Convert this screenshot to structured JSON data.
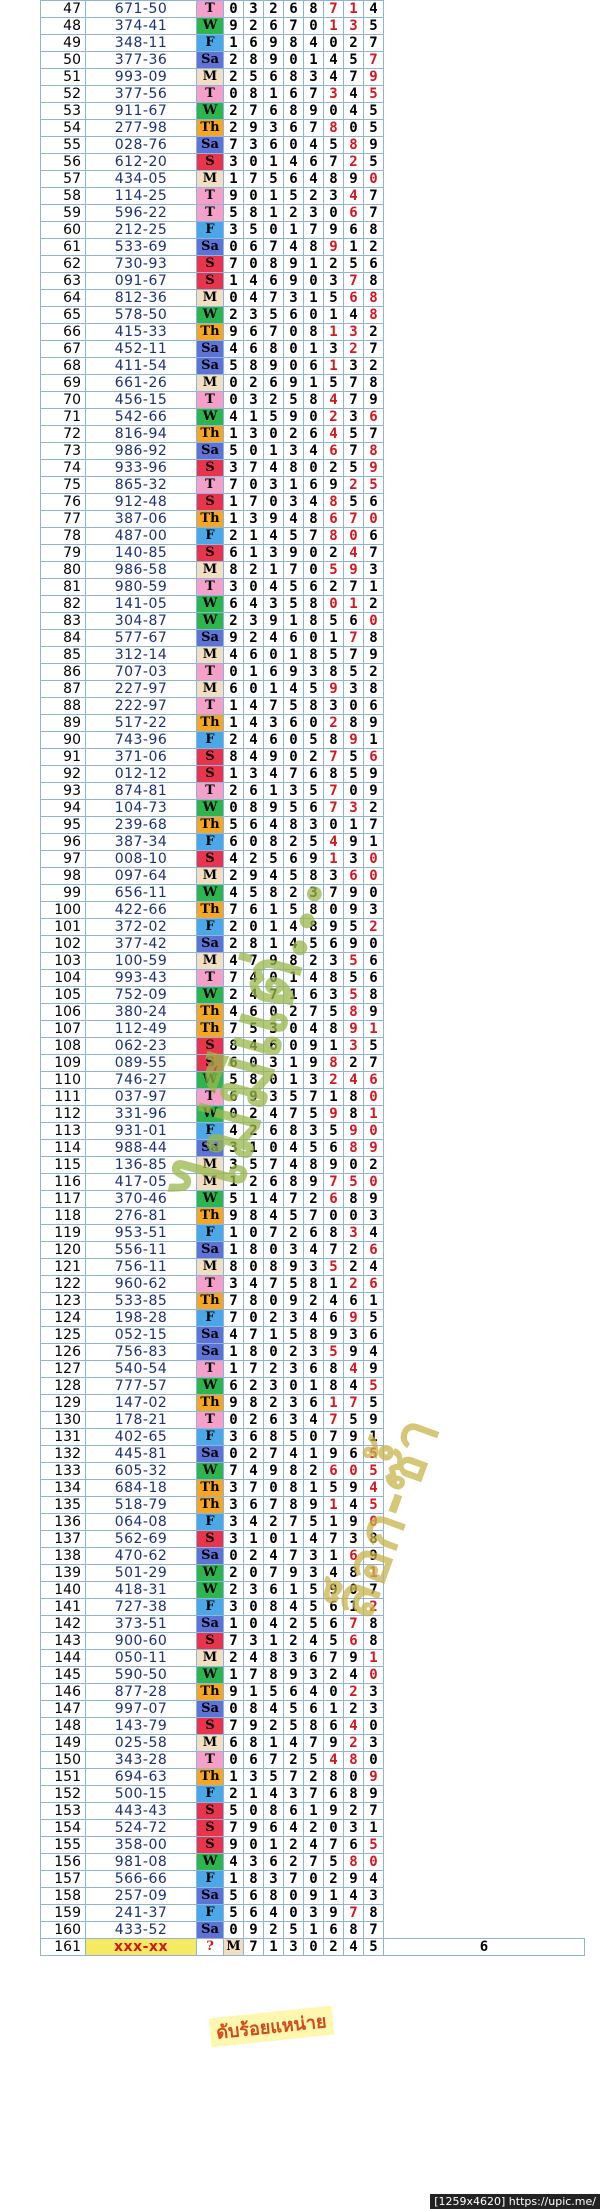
{
  "rows": [
    {
      "no": "47",
      "pair": "671-50",
      "day": "T",
      "digits": "03268714"
    },
    {
      "no": "48",
      "pair": "374-41",
      "day": "W",
      "digits": "92670135"
    },
    {
      "no": "49",
      "pair": "348-11",
      "day": "F",
      "digits": "16984027"
    },
    {
      "no": "50",
      "pair": "377-36",
      "day": "Sa",
      "digits": "28901457"
    },
    {
      "no": "51",
      "pair": "993-09",
      "day": "M",
      "digits": "25683479"
    },
    {
      "no": "52",
      "pair": "377-56",
      "day": "T",
      "digits": "08167345"
    },
    {
      "no": "53",
      "pair": "911-67",
      "day": "W",
      "digits": "27689045"
    },
    {
      "no": "54",
      "pair": "277-98",
      "day": "Th",
      "digits": "29367805"
    },
    {
      "no": "55",
      "pair": "028-76",
      "day": "Sa",
      "digits": "73604589"
    },
    {
      "no": "56",
      "pair": "612-20",
      "day": "S",
      "digits": "30146725"
    },
    {
      "no": "57",
      "pair": "434-05",
      "day": "M",
      "digits": "17564890"
    },
    {
      "no": "58",
      "pair": "114-25",
      "day": "T",
      "digits": "90152347"
    },
    {
      "no": "59",
      "pair": "596-22",
      "day": "T",
      "digits": "58123067"
    },
    {
      "no": "60",
      "pair": "212-25",
      "day": "F",
      "digits": "35017968"
    },
    {
      "no": "61",
      "pair": "533-69",
      "day": "Sa",
      "digits": "06748912"
    },
    {
      "no": "62",
      "pair": "730-93",
      "day": "S",
      "digits": "70891256"
    },
    {
      "no": "63",
      "pair": "091-67",
      "day": "S",
      "digits": "14690378"
    },
    {
      "no": "64",
      "pair": "812-36",
      "day": "M",
      "digits": "04731568"
    },
    {
      "no": "65",
      "pair": "578-50",
      "day": "W",
      "digits": "23560148"
    },
    {
      "no": "66",
      "pair": "415-33",
      "day": "Th",
      "digits": "96708132"
    },
    {
      "no": "67",
      "pair": "452-11",
      "day": "Sa",
      "digits": "46801327"
    },
    {
      "no": "68",
      "pair": "411-54",
      "day": "Sa",
      "digits": "58906132"
    },
    {
      "no": "69",
      "pair": "661-26",
      "day": "M",
      "digits": "02691578"
    },
    {
      "no": "70",
      "pair": "456-15",
      "day": "T",
      "digits": "03258479"
    },
    {
      "no": "71",
      "pair": "542-66",
      "day": "W",
      "digits": "41590236"
    },
    {
      "no": "72",
      "pair": "816-94",
      "day": "Th",
      "digits": "13026457"
    },
    {
      "no": "73",
      "pair": "986-92",
      "day": "Sa",
      "digits": "50134678"
    },
    {
      "no": "74",
      "pair": "933-96",
      "day": "S",
      "digits": "37480259"
    },
    {
      "no": "75",
      "pair": "865-32",
      "day": "T",
      "digits": "70316925"
    },
    {
      "no": "76",
      "pair": "912-48",
      "day": "S",
      "digits": "17034856"
    },
    {
      "no": "77",
      "pair": "387-06",
      "day": "Th",
      "digits": "13948670"
    },
    {
      "no": "78",
      "pair": "487-00",
      "day": "F",
      "digits": "21457806"
    },
    {
      "no": "79",
      "pair": "140-85",
      "day": "S",
      "digits": "61390247"
    },
    {
      "no": "80",
      "pair": "986-58",
      "day": "M",
      "digits": "82170593"
    },
    {
      "no": "81",
      "pair": "980-59",
      "day": "T",
      "digits": "30456271"
    },
    {
      "no": "82",
      "pair": "141-05",
      "day": "W",
      "digits": "64358012"
    },
    {
      "no": "83",
      "pair": "304-87",
      "day": "W",
      "digits": "23918560"
    },
    {
      "no": "84",
      "pair": "577-67",
      "day": "Sa",
      "digits": "92460178"
    },
    {
      "no": "85",
      "pair": "312-14",
      "day": "M",
      "digits": "46018579"
    },
    {
      "no": "86",
      "pair": "707-03",
      "day": "T",
      "digits": "01693852"
    },
    {
      "no": "87",
      "pair": "227-97",
      "day": "M",
      "digits": "60145938"
    },
    {
      "no": "88",
      "pair": "222-97",
      "day": "T",
      "digits": "14758306"
    },
    {
      "no": "89",
      "pair": "517-22",
      "day": "Th",
      "digits": "14360289"
    },
    {
      "no": "90",
      "pair": "743-96",
      "day": "F",
      "digits": "24605891"
    },
    {
      "no": "91",
      "pair": "371-06",
      "day": "S",
      "digits": "84902756"
    },
    {
      "no": "92",
      "pair": "012-12",
      "day": "S",
      "digits": "13476859"
    },
    {
      "no": "93",
      "pair": "874-81",
      "day": "T",
      "digits": "26135709"
    },
    {
      "no": "94",
      "pair": "104-73",
      "day": "W",
      "digits": "08956732"
    },
    {
      "no": "95",
      "pair": "239-68",
      "day": "Th",
      "digits": "56483017"
    },
    {
      "no": "96",
      "pair": "387-34",
      "day": "F",
      "digits": "60825491"
    },
    {
      "no": "97",
      "pair": "008-10",
      "day": "S",
      "digits": "42569130"
    },
    {
      "no": "98",
      "pair": "097-64",
      "day": "M",
      "digits": "29458360"
    },
    {
      "no": "99",
      "pair": "656-11",
      "day": "W",
      "digits": "45823790"
    },
    {
      "no": "100",
      "pair": "422-66",
      "day": "Th",
      "digits": "76158093"
    },
    {
      "no": "101",
      "pair": "372-02",
      "day": "F",
      "digits": "20148952"
    },
    {
      "no": "102",
      "pair": "377-42",
      "day": "Sa",
      "digits": "28145690"
    },
    {
      "no": "103",
      "pair": "100-59",
      "day": "M",
      "digits": "47982356"
    },
    {
      "no": "104",
      "pair": "993-43",
      "day": "T",
      "digits": "74014856"
    },
    {
      "no": "105",
      "pair": "752-09",
      "day": "W",
      "digits": "24716358"
    },
    {
      "no": "106",
      "pair": "380-24",
      "day": "Th",
      "digits": "46027589"
    },
    {
      "no": "107",
      "pair": "112-49",
      "day": "Th",
      "digits": "75304891"
    },
    {
      "no": "108",
      "pair": "062-23",
      "day": "S",
      "digits": "84609135"
    },
    {
      "no": "109",
      "pair": "089-55",
      "day": "S",
      "digits": "60319827"
    },
    {
      "no": "110",
      "pair": "746-27",
      "day": "W",
      "digits": "58013246"
    },
    {
      "no": "111",
      "pair": "037-97",
      "day": "T",
      "digits": "69357180"
    },
    {
      "no": "112",
      "pair": "331-96",
      "day": "W",
      "digits": "02475981"
    },
    {
      "no": "113",
      "pair": "931-01",
      "day": "F",
      "digits": "42683590"
    },
    {
      "no": "114",
      "pair": "988-44",
      "day": "Sa",
      "digits": "31045689"
    },
    {
      "no": "115",
      "pair": "136-85",
      "day": "M",
      "digits": "35748902"
    },
    {
      "no": "116",
      "pair": "417-05",
      "day": "M",
      "digits": "12689750"
    },
    {
      "no": "117",
      "pair": "370-46",
      "day": "W",
      "digits": "51472689"
    },
    {
      "no": "118",
      "pair": "276-81",
      "day": "Th",
      "digits": "98457003"
    },
    {
      "no": "119",
      "pair": "953-51",
      "day": "F",
      "digits": "10726834"
    },
    {
      "no": "120",
      "pair": "556-11",
      "day": "Sa",
      "digits": "18034726"
    },
    {
      "no": "121",
      "pair": "756-11",
      "day": "M",
      "digits": "80893524"
    },
    {
      "no": "122",
      "pair": "960-62",
      "day": "T",
      "digits": "34758126"
    },
    {
      "no": "123",
      "pair": "533-85",
      "day": "Th",
      "digits": "78092461"
    },
    {
      "no": "124",
      "pair": "198-28",
      "day": "F",
      "digits": "70234695"
    },
    {
      "no": "125",
      "pair": "052-15",
      "day": "Sa",
      "digits": "47158936"
    },
    {
      "no": "126",
      "pair": "756-83",
      "day": "Sa",
      "digits": "18023594"
    },
    {
      "no": "127",
      "pair": "540-54",
      "day": "T",
      "digits": "17236849"
    },
    {
      "no": "128",
      "pair": "777-57",
      "day": "W",
      "digits": "62301845"
    },
    {
      "no": "129",
      "pair": "147-02",
      "day": "Th",
      "digits": "98236175"
    },
    {
      "no": "130",
      "pair": "178-21",
      "day": "T",
      "digits": "02634759"
    },
    {
      "no": "131",
      "pair": "402-65",
      "day": "F",
      "digits": "36850791"
    },
    {
      "no": "132",
      "pair": "445-81",
      "day": "Sa",
      "digits": "02741965"
    },
    {
      "no": "133",
      "pair": "605-32",
      "day": "W",
      "digits": "74982605"
    },
    {
      "no": "134",
      "pair": "684-18",
      "day": "Th",
      "digits": "37081594"
    },
    {
      "no": "135",
      "pair": "518-79",
      "day": "Th",
      "digits": "36789145"
    },
    {
      "no": "136",
      "pair": "064-08",
      "day": "F",
      "digits": "34275190"
    },
    {
      "no": "137",
      "pair": "562-69",
      "day": "S",
      "digits": "31014738"
    },
    {
      "no": "138",
      "pair": "470-62",
      "day": "Sa",
      "digits": "02473169"
    },
    {
      "no": "139",
      "pair": "501-29",
      "day": "W",
      "digits": "20793481"
    },
    {
      "no": "140",
      "pair": "418-31",
      "day": "W",
      "digits": "23615907"
    },
    {
      "no": "141",
      "pair": "727-38",
      "day": "F",
      "digits": "30845612"
    },
    {
      "no": "142",
      "pair": "373-51",
      "day": "Sa",
      "digits": "10425678"
    },
    {
      "no": "143",
      "pair": "900-60",
      "day": "S",
      "digits": "73124568"
    },
    {
      "no": "144",
      "pair": "050-11",
      "day": "M",
      "digits": "24836791"
    },
    {
      "no": "145",
      "pair": "590-50",
      "day": "W",
      "digits": "17893240"
    },
    {
      "no": "146",
      "pair": "877-28",
      "day": "Th",
      "digits": "91564023"
    },
    {
      "no": "147",
      "pair": "997-07",
      "day": "Sa",
      "digits": "08456123"
    },
    {
      "no": "148",
      "pair": "143-79",
      "day": "S",
      "digits": "79258640"
    },
    {
      "no": "149",
      "pair": "025-58",
      "day": "M",
      "digits": "68147923"
    },
    {
      "no": "150",
      "pair": "343-28",
      "day": "T",
      "digits": "06725480"
    },
    {
      "no": "151",
      "pair": "694-63",
      "day": "Th",
      "digits": "13572809"
    },
    {
      "no": "152",
      "pair": "500-15",
      "day": "F",
      "digits": "21437689"
    },
    {
      "no": "153",
      "pair": "443-43",
      "day": "S",
      "digits": "50861927"
    },
    {
      "no": "154",
      "pair": "524-72",
      "day": "S",
      "digits": "79642031"
    },
    {
      "no": "155",
      "pair": "358-00",
      "day": "S",
      "digits": "90124765"
    },
    {
      "no": "156",
      "pair": "981-08",
      "day": "W",
      "digits": "43627580"
    },
    {
      "no": "157",
      "pair": "566-66",
      "day": "F",
      "digits": "18370294"
    },
    {
      "no": "158",
      "pair": "257-09",
      "day": "Sa",
      "digits": "56809143"
    },
    {
      "no": "159",
      "pair": "241-37",
      "day": "F",
      "digits": "56403978"
    },
    {
      "no": "160",
      "pair": "433-52",
      "day": "Sa",
      "digits": "09251687"
    },
    {
      "no": "161",
      "pair": "xxx-xx",
      "day": "M",
      "digits": "71302456"
    }
  ],
  "last_row_marker": "?",
  "watermark_main": "ไม่มีแต่...",
  "watermark_second": "ล็อก-ซ้ำ",
  "stamp_text": "ดับร้อยแหน่าย",
  "footer_text": "[1259x4620] https://upic.me/",
  "day_colors": {
    "M": "#f2dfc2",
    "T": "#f4a0c8",
    "W": "#2db64e",
    "Th": "#f5a623",
    "F": "#4aa8e8",
    "Sa": "#5e73d6",
    "S": "#e8344c"
  },
  "digit_colors": {
    "normal": "#000000",
    "highlight": "#d7151c"
  }
}
